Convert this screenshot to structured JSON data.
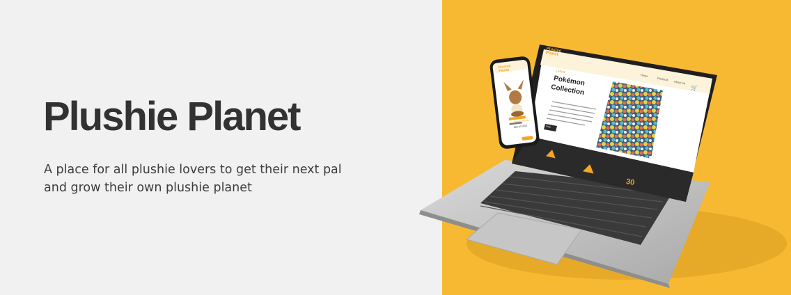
{
  "hero": {
    "title": "Plushie Planet",
    "tagline": "A place for all plushie lovers to get their next pal and grow their own plushie planet"
  },
  "laptop_screen": {
    "logo": "Plushie Planet",
    "nav": [
      "Home",
      "Products",
      "About Us"
    ],
    "kicker": "Latest",
    "headline_1": "Pokémon",
    "headline_2": "Collection",
    "button": "Shop",
    "footer_badge": "30"
  },
  "phone_screen": {
    "logo": "Plushie Planet",
    "product_name": "Eevee Plushie",
    "price": "$25.00 USD"
  },
  "colors": {
    "left_bg": "#f1f1f1",
    "right_bg": "#f8b932",
    "title": "#323232",
    "accent": "#f5a623"
  }
}
